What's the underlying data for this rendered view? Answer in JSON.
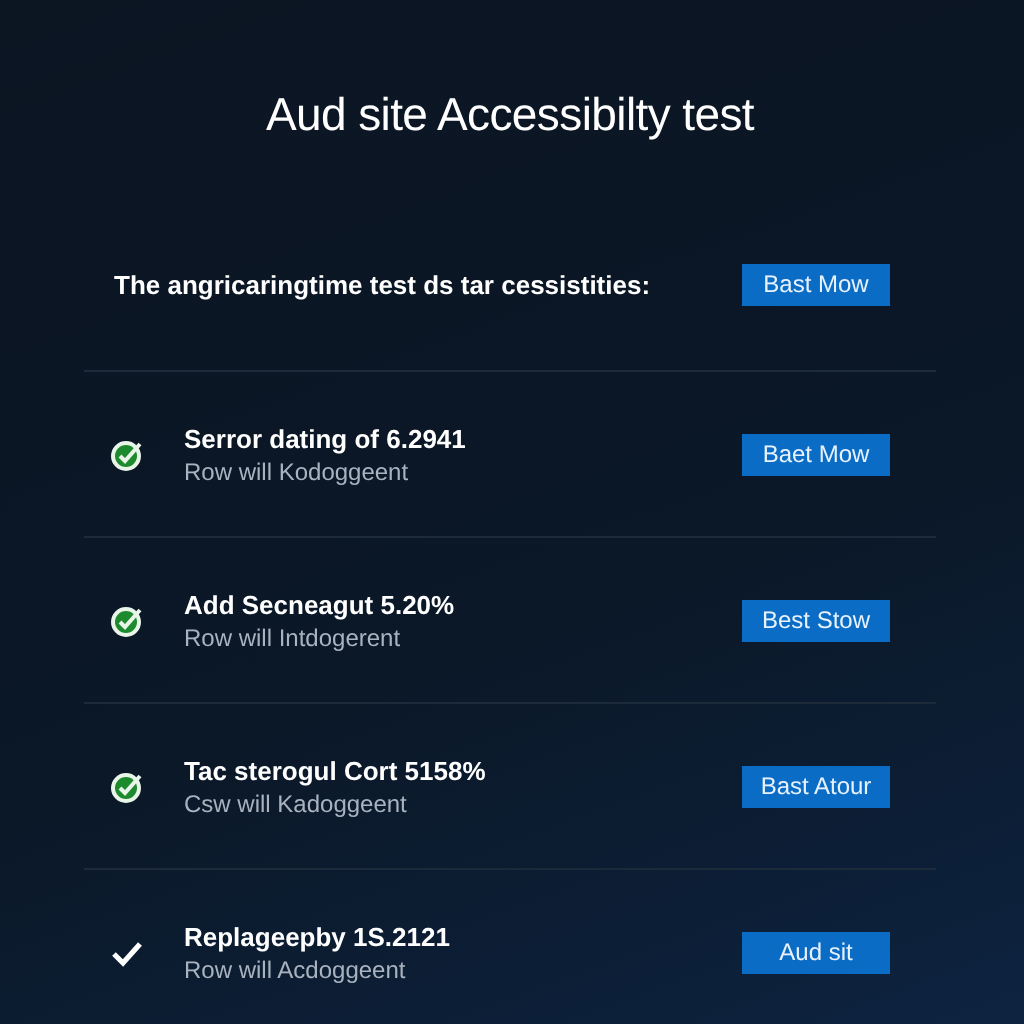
{
  "title": "Aud site Accessibilty test",
  "intro": {
    "text": "The angricaringtime test ds tar cessistities:",
    "button": "Bast Mow"
  },
  "items": [
    {
      "kind": "badge",
      "title": "Serror dating of 6.2941",
      "subtitle": "Row will Kodoggeent",
      "button": "Baet Mow"
    },
    {
      "kind": "badge",
      "title": "Add Secneagut 5.20%",
      "subtitle": "Row will Intdogerent",
      "button": "Best Stow"
    },
    {
      "kind": "badge",
      "title": "Tac sterogul Cort 5158%",
      "subtitle": "Csw will Kadoggeent",
      "button": "Bast Atour"
    },
    {
      "kind": "check",
      "title": "Replageepby 1S.2121",
      "subtitle": "Row will Acdoggeent",
      "button": "Aud sit"
    }
  ]
}
